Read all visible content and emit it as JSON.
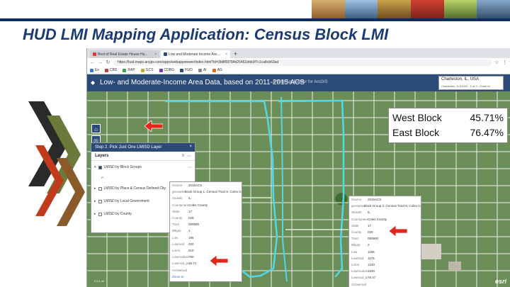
{
  "slide": {
    "title": "HUD LMI Mapping Application: Census Block LMI"
  },
  "browser": {
    "tabs": [
      {
        "label": "Best of Real Estate House Hu...",
        "close": "×"
      },
      {
        "label": "Low and Moderate Income Are...",
        "close": "×"
      }
    ],
    "new_tab": "+",
    "url": "https://hud.maps.arcgis.com/apps/webappviewer/index.html?id=3b8f09784d26461bbb3f7c1ca8cb63ad",
    "bookmarks": [
      "Ex",
      "CBD",
      "RAP",
      "GCS",
      "CDBG",
      "HUD",
      "AI",
      "AG"
    ]
  },
  "app": {
    "logo": "◆",
    "title": "Low- and Moderate-Income Area Data, based on 2011-2015 ACS",
    "subtitle": "A Web AppBuilder for ArcGIS",
    "search_value": "Charleston, IL, USA",
    "search_sub": "Charleston, IL 61920 · 1 of 3 · Zoom to"
  },
  "layer_panel": {
    "header": "Step 2. Pick Just One LMISD Layer",
    "close": "×",
    "layers_label": "Layers",
    "tools": [
      "≡",
      "⋯"
    ],
    "layers": [
      {
        "label": "LMISD by Block Groups",
        "expanded": true
      },
      {
        "label": "LMISD by Place & Census Defined City",
        "expanded": false
      },
      {
        "label": "LMISD by Local Government",
        "expanded": false
      },
      {
        "label": "LMISD by County",
        "expanded": false
      }
    ]
  },
  "popup_left": {
    "rows": [
      {
        "key": "Source",
        "value": "2015ACS"
      },
      {
        "key": "geoname",
        "value": "Block Group 1, Census Tract 9, Coles County, Illinois"
      },
      {
        "key": "Stusab",
        "value": "IL"
      },
      {
        "key": "Countyname",
        "value": "Coles County"
      },
      {
        "key": "State",
        "value": "17"
      },
      {
        "key": "County",
        "value": "029"
      },
      {
        "key": "Tract",
        "value": "000900"
      },
      {
        "key": "Blkgrp",
        "value": "1"
      },
      {
        "key": "Low",
        "value": "195"
      },
      {
        "key": "Lowmod",
        "value": "320"
      },
      {
        "key": "Lmmi",
        "value": "510"
      },
      {
        "key": "Lowmoduniv",
        "value": "700"
      },
      {
        "key": "Lowmod_pct",
        "value": "45.71"
      },
      {
        "key": "Uclowmod",
        "value": ""
      }
    ],
    "link": "Zoom to"
  },
  "popup_right": {
    "rows": [
      {
        "key": "Source",
        "value": "2015ACS"
      },
      {
        "key": "geoname",
        "value": "Block Group 2, Census Tract 9, Coles County, Illinois"
      },
      {
        "key": "Stusab",
        "value": "IL"
      },
      {
        "key": "Countyname",
        "value": "Coles County"
      },
      {
        "key": "State",
        "value": "17"
      },
      {
        "key": "County",
        "value": "029"
      },
      {
        "key": "Tract",
        "value": "000900"
      },
      {
        "key": "Blkgrp",
        "value": "2"
      },
      {
        "key": "Low",
        "value": "1165"
      },
      {
        "key": "Lowmod",
        "value": "1175"
      },
      {
        "key": "Lmmi",
        "value": "1240"
      },
      {
        "key": "Lowmoduniv",
        "value": "1530"
      },
      {
        "key": "Lowmod_pct",
        "value": "76.47"
      },
      {
        "key": "Uclowmod",
        "value": ""
      }
    ],
    "link": "Zoom to"
  },
  "map": {
    "scale": "0       0.1 mi",
    "esri": "esri",
    "controls": [
      "+",
      "−",
      "⌂",
      "◎"
    ]
  },
  "stats": [
    {
      "name": "West Block",
      "value": "45.71%"
    },
    {
      "name": "East Block",
      "value": "76.47%"
    }
  ],
  "colors": {
    "brand": "#1b3a73",
    "app_header": "#2b4a78",
    "boundary": "#4fd8e8",
    "annotation": "#e3261c"
  }
}
